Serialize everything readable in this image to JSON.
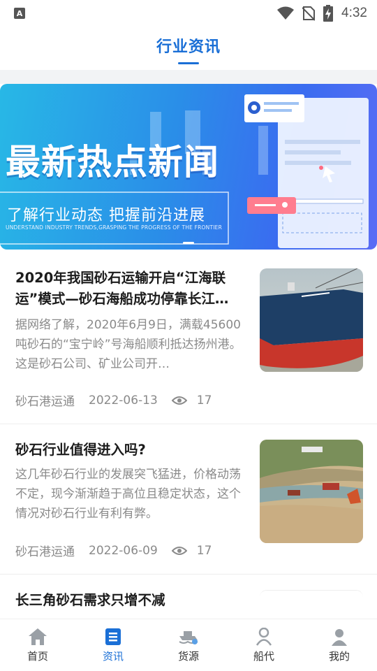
{
  "status_bar": {
    "time": "4:32",
    "left_badge": "A"
  },
  "header": {
    "title": "行业资讯"
  },
  "banner": {
    "title": "最新热点新闻",
    "subtitle": "了解行业动态  把握前沿进展",
    "subtitle_en": "UNDERSTAND INDUSTRY TRENDS,GRASPING THE PROGRESS OF THE FRONTIER"
  },
  "news": [
    {
      "title": "2020年我国砂石运输开启“江海联运”模式—砂石海船成功停靠长江…",
      "summary": "据网络了解，2020年6月9日，满载45600吨砂石的“宝宁岭”号海船顺利抵达扬州港。这是砂石公司、矿业公司开…",
      "source": "砂石港运通",
      "date": "2022-06-13",
      "views": "17",
      "thumb": "ship-photo"
    },
    {
      "title": "砂石行业值得进入吗?",
      "summary": "这几年砂石行业的发展突飞猛进，价格动荡不定，现今渐渐趋于高位且稳定状态，这个情况对砂石行业有利有弊。",
      "source": "砂石港运通",
      "date": "2022-06-09",
      "views": "17",
      "thumb": "quarry-photo"
    },
    {
      "title": "长三角砂石需求只增不减"
    }
  ],
  "tabs": [
    {
      "label": "首页",
      "icon": "home-icon",
      "active": false
    },
    {
      "label": "资讯",
      "icon": "news-icon",
      "active": true
    },
    {
      "label": "货源",
      "icon": "cargo-icon",
      "active": false
    },
    {
      "label": "船代",
      "icon": "ship-agent-icon",
      "active": false
    },
    {
      "label": "我的",
      "icon": "profile-icon",
      "active": false
    }
  ],
  "colors": {
    "accent": "#1a6fd6",
    "text": "#1c1c1c",
    "muted": "#8a8a8a",
    "tab_inactive": "#9aa0a6"
  }
}
